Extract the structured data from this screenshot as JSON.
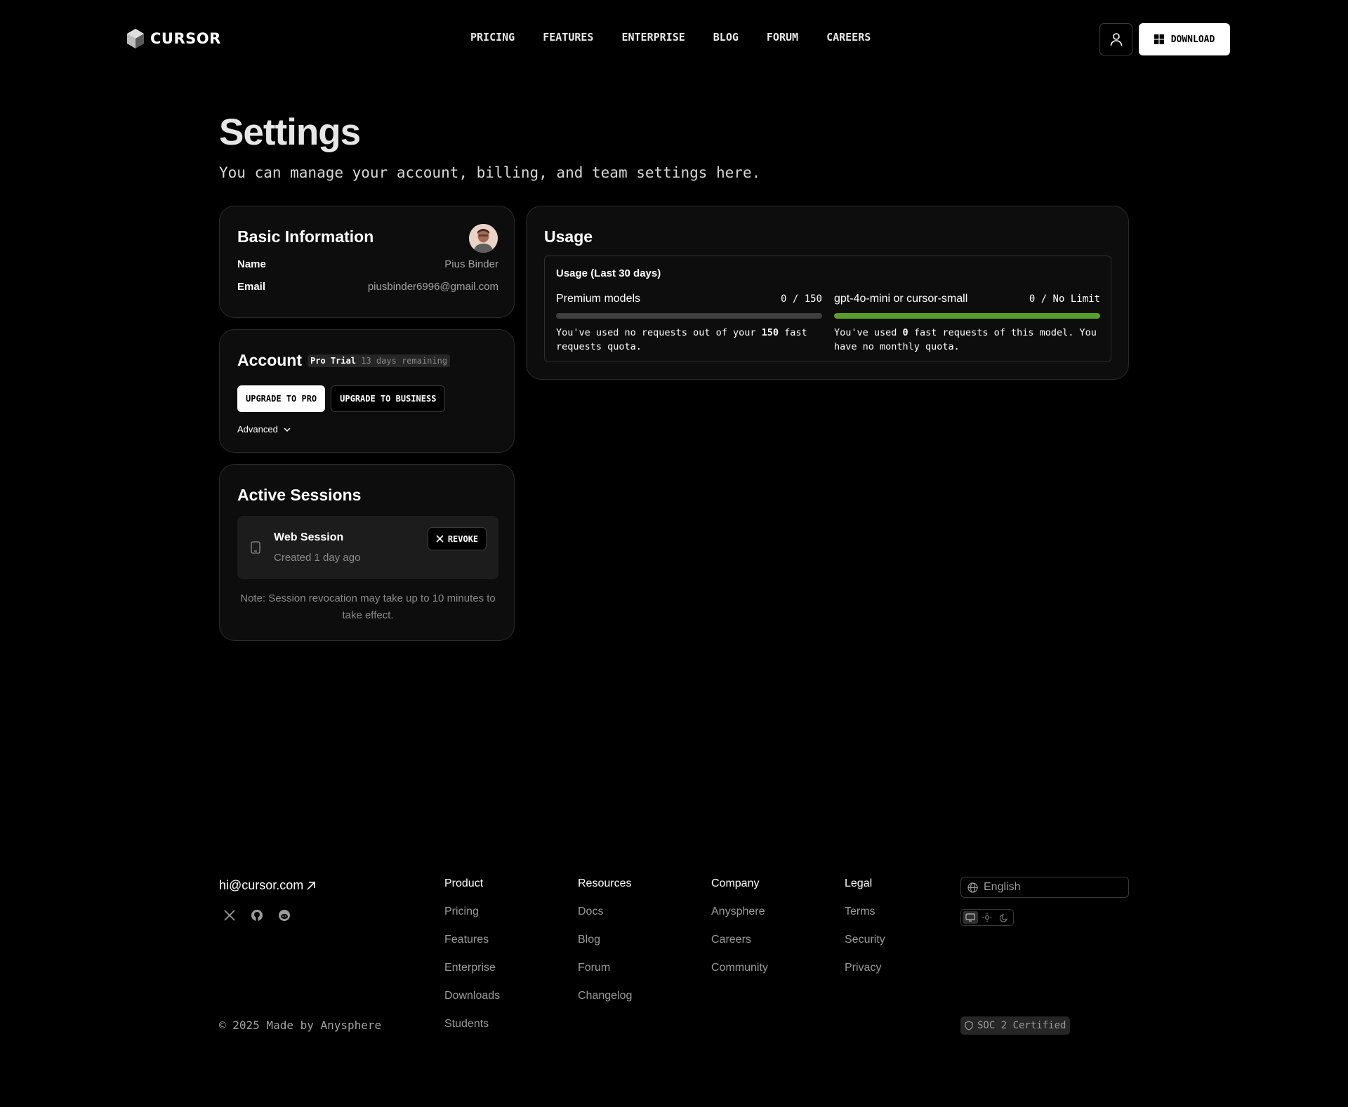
{
  "brand": {
    "name": "CURSOR"
  },
  "nav": {
    "links": [
      "PRICING",
      "FEATURES",
      "ENTERPRISE",
      "BLOG",
      "FORUM",
      "CAREERS"
    ],
    "download_label": "DOWNLOAD",
    "user_icon": "user-icon",
    "download_icon": "windows-icon"
  },
  "header": {
    "title": "Settings",
    "subtitle": "You can manage your account, billing, and team settings here."
  },
  "basic_info": {
    "title": "Basic Information",
    "name_label": "Name",
    "name_value": "Pius Binder",
    "email_label": "Email",
    "email_value": "piusbinder6996@gmail.com"
  },
  "account": {
    "title": "Account",
    "plan": "Pro Trial",
    "remaining": "13 days remaining",
    "upgrade_pro": "UPGRADE TO PRO",
    "upgrade_business": "UPGRADE TO BUSINESS",
    "advanced": "Advanced"
  },
  "sessions": {
    "title": "Active Sessions",
    "session_name": "Web Session",
    "session_created": "Created 1 day ago",
    "revoke_label": "REVOKE",
    "note": "Note: Session revocation may take up to 10 minutes to take effect."
  },
  "usage": {
    "title": "Usage",
    "box_title": "Usage (Last 30 days)",
    "meters": [
      {
        "label": "Premium models",
        "count": "0 / 150",
        "fill_fraction": 0,
        "desc_pre": "You've used no requests out of your ",
        "desc_bold": "150",
        "desc_post": " fast requests quota."
      },
      {
        "label": "gpt-4o-mini or cursor-small",
        "count": "0 / No Limit",
        "fill_fraction": 1,
        "desc_pre": "You've used ",
        "desc_bold": "0",
        "desc_post": " fast requests of this model. You have no monthly quota."
      }
    ],
    "accent_color": "#5b9f2b"
  },
  "footer": {
    "email": "hi@cursor.com",
    "copyright": "© 2025 Made by Anysphere",
    "columns": [
      {
        "title": "Product",
        "links": [
          "Pricing",
          "Features",
          "Enterprise",
          "Downloads",
          "Students"
        ]
      },
      {
        "title": "Resources",
        "links": [
          "Docs",
          "Blog",
          "Forum",
          "Changelog"
        ]
      },
      {
        "title": "Company",
        "links": [
          "Anysphere",
          "Careers",
          "Community"
        ]
      },
      {
        "title": "Legal",
        "links": [
          "Terms",
          "Security",
          "Privacy"
        ]
      }
    ],
    "language": "English",
    "soc": "SOC 2 Certified",
    "social_icons": [
      "x-icon",
      "github-icon",
      "reddit-icon"
    ]
  }
}
